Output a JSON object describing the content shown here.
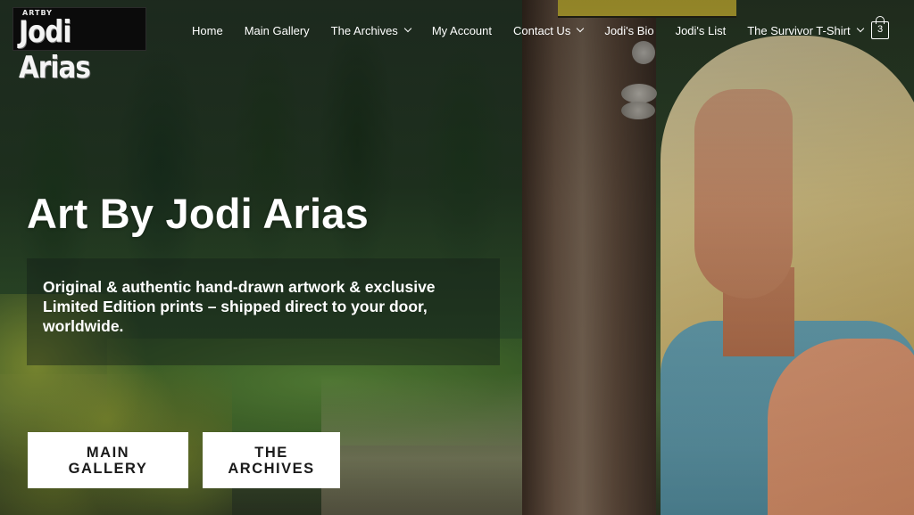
{
  "logo": {
    "small_text": "ARTBY",
    "main_text": "Jodi Arias"
  },
  "nav": {
    "items": [
      {
        "label": "Home",
        "has_dropdown": false
      },
      {
        "label": "Main Gallery",
        "has_dropdown": false
      },
      {
        "label": "The Archives",
        "has_dropdown": true
      },
      {
        "label": "My Account",
        "has_dropdown": false
      },
      {
        "label": "Contact Us",
        "has_dropdown": true
      },
      {
        "label": "Jodi's Bio",
        "has_dropdown": false
      },
      {
        "label": "Jodi's List",
        "has_dropdown": false
      },
      {
        "label": "The Survivor T-Shirt",
        "has_dropdown": true
      }
    ],
    "cart_count": "3"
  },
  "hero": {
    "title": "Art By Jodi Arias",
    "subtitle": "Original & authentic hand-drawn artwork & exclusive Limited Edition prints – shipped direct to your door, worldwide.",
    "buttons": [
      {
        "line1": "MAIN",
        "line2": "GALLERY"
      },
      {
        "line1": "THE",
        "line2": "ARCHIVES"
      }
    ]
  },
  "colors": {
    "text": "#ffffff",
    "button_bg": "#ffffff",
    "button_text": "#1a1a1a"
  }
}
